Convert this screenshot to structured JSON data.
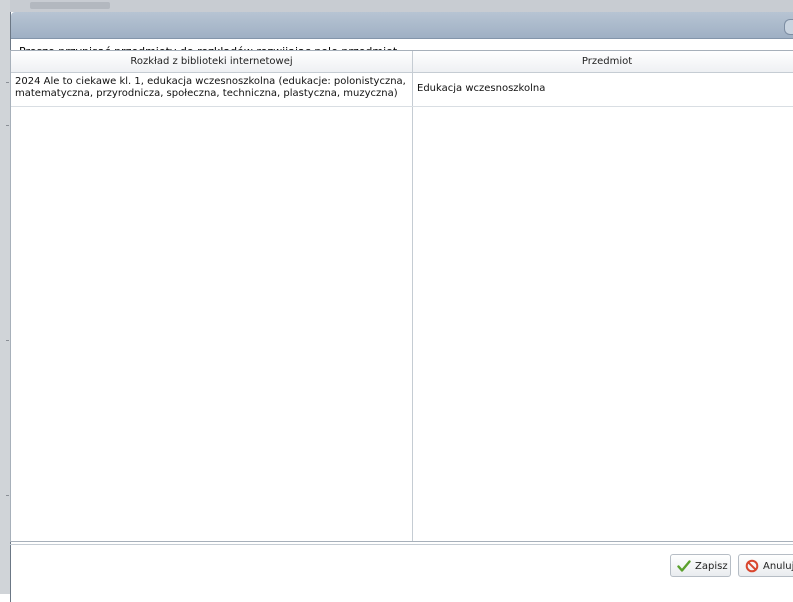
{
  "dialog": {
    "instruction": "Proszę przypisać przedmioty do rozkładów rozwijając pole przedmiot."
  },
  "grid": {
    "columns": [
      "Rozkład z biblioteki internetowej",
      "Przedmiot"
    ],
    "rows": [
      {
        "rozklad": "2024 Ale to ciekawe kl. 1, edukacja wczesnoszkolna (edukacje: polonistyczna, matematyczna, przyrodnicza, społeczna, techniczna, plastyczna, muzyczna)",
        "przedmiot": "Edukacja wczesnoszkolna"
      }
    ]
  },
  "buttons": {
    "save": "Zapisz",
    "cancel": "Anuluj"
  },
  "icons": {
    "save": "checkmark-icon",
    "cancel": "forbidden-icon",
    "dropdown": "chevron-down-icon"
  },
  "colors": {
    "titlebar": "#a9b8cb",
    "save_icon": "#5aa02c",
    "cancel_icon": "#d9472f"
  }
}
